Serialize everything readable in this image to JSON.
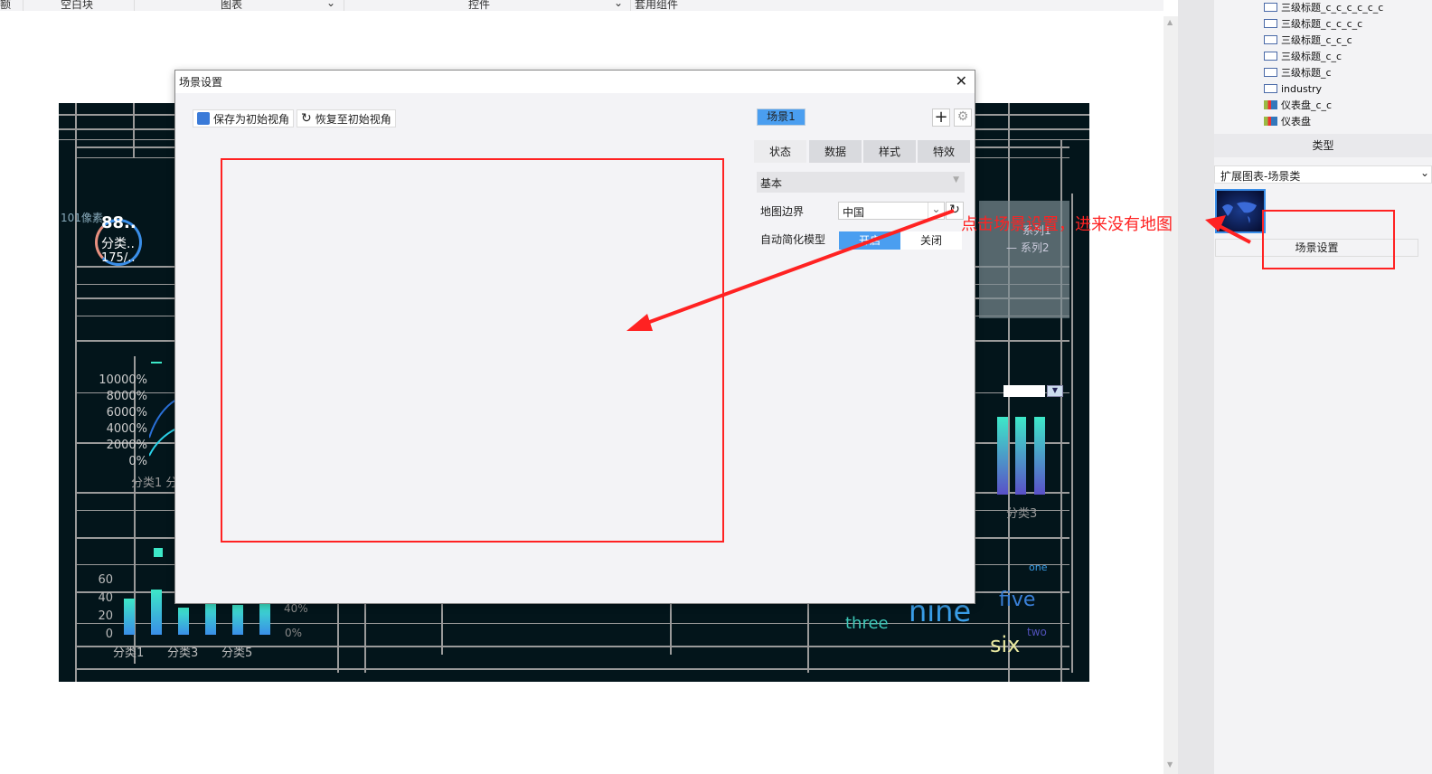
{
  "toolbar": {
    "items": [
      "额",
      "空白块",
      "图表",
      "控件",
      "套用组件"
    ]
  },
  "tree": {
    "items": [
      "三级标题_c_c_c_c_c_c",
      "三级标题_c_c_c_c",
      "三级标题_c_c_c",
      "三级标题_c_c",
      "三级标题_c",
      "industry",
      "仪表盘_c_c",
      "仪表盘"
    ]
  },
  "right_panel": {
    "type_header": "类型",
    "type_select": "扩展图表-场景类",
    "component_label": "场景设置"
  },
  "dialog": {
    "title": "场景设置",
    "save_view": "保存为初始视角",
    "restore_view": "恢复至初始视角",
    "scene_tag": "场景1",
    "tabs": [
      "状态",
      "数据",
      "样式",
      "特效"
    ],
    "section": "基本",
    "map_boundary_label": "地图边界",
    "map_boundary_value": "中国",
    "auto_simplify_label": "自动简化模型",
    "toggle_on": "开启",
    "toggle_off": "关闭"
  },
  "annotation": {
    "text": "点击场景设置，进来没有地图",
    "color": "#ff2222"
  },
  "dashboard": {
    "gauge": {
      "label": "101像素",
      "value": "88..",
      "category": "分类..",
      "sub": "175/.."
    },
    "line_yticks": [
      "10000%",
      "8000%",
      "6000%",
      "4000%",
      "2000%",
      "0%"
    ],
    "line_xlabel": "分类1 分",
    "bar_yticks": [
      "60",
      "40",
      "20",
      "0"
    ],
    "bar_xlabels": [
      "分类1",
      "分类3",
      "分类5"
    ],
    "bar_values": [
      40,
      50,
      30,
      35,
      33,
      35
    ],
    "bar_right_ticks": [
      "40%",
      "0%"
    ],
    "legend_series2": "— 系列2",
    "legend_series1": "系列1",
    "vbar_xlabel": "分类3",
    "words": [
      "three",
      "nine",
      "five",
      "six",
      "one",
      "two"
    ]
  }
}
